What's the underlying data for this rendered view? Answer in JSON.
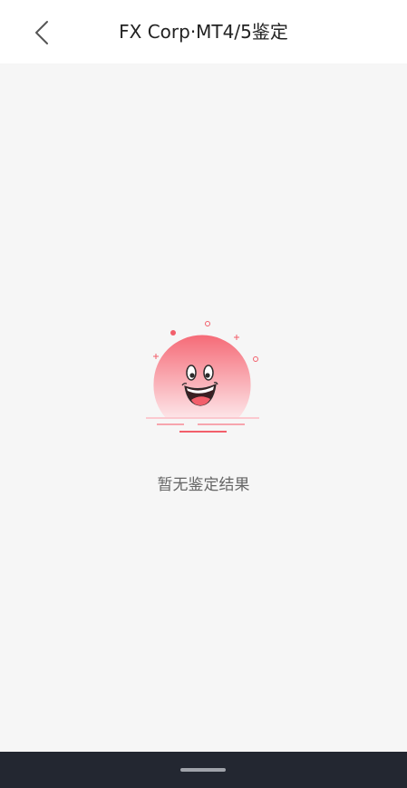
{
  "header": {
    "title": "FX Corp·MT4/5鉴定",
    "back_icon": "chevron-left-icon"
  },
  "empty_state": {
    "illustration": "smiling-sun-illustration",
    "message": "暂无鉴定结果"
  },
  "system_nav": {
    "home_indicator": "home-indicator"
  },
  "colors": {
    "accent": "#f25f6b",
    "header_bg": "#ffffff",
    "page_bg": "#f6f6f6",
    "nav_bg": "#232731"
  }
}
